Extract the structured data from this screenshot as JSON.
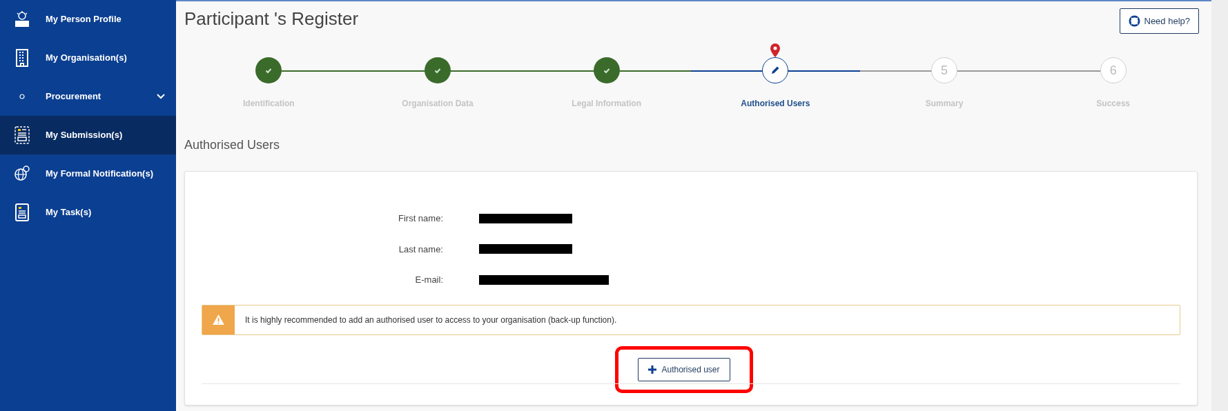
{
  "sidebar": {
    "items": [
      {
        "label": "My Person Profile",
        "kind": "link",
        "selected": false
      },
      {
        "label": "My Organisation(s)",
        "kind": "link",
        "selected": false
      },
      {
        "label": "Procurement",
        "kind": "group",
        "expanded": false,
        "selected": false
      },
      {
        "label": "My Submission(s)",
        "kind": "link",
        "selected": true
      },
      {
        "label": "My Formal Notification(s)",
        "kind": "link",
        "selected": false
      },
      {
        "label": "My Task(s)",
        "kind": "link",
        "selected": false
      }
    ]
  },
  "page": {
    "title": "Participant 's Register",
    "help_button": "Need help?"
  },
  "stepper": [
    {
      "label": "Identification",
      "done": true,
      "current": false
    },
    {
      "label": "Organisation Data",
      "done": true,
      "current": false
    },
    {
      "label": "Legal Information",
      "done": true,
      "current": false
    },
    {
      "label": "Authorised Users",
      "done": false,
      "current": true
    },
    {
      "label": "Summary",
      "done": false,
      "current": false,
      "number": "5"
    },
    {
      "label": "Success",
      "done": false,
      "current": false,
      "number": "6"
    }
  ],
  "section": {
    "heading": "Authorised Users",
    "fields": [
      {
        "label": "First name:",
        "kind": "name"
      },
      {
        "label": "Last name:",
        "kind": "name"
      },
      {
        "label": "E-mail:",
        "kind": "email"
      }
    ],
    "warning": "It is highly recommended to add an authorised user to access to your organisation (back-up function).",
    "add_button": {
      "label": "Authorised user",
      "highlighted": true
    }
  }
}
